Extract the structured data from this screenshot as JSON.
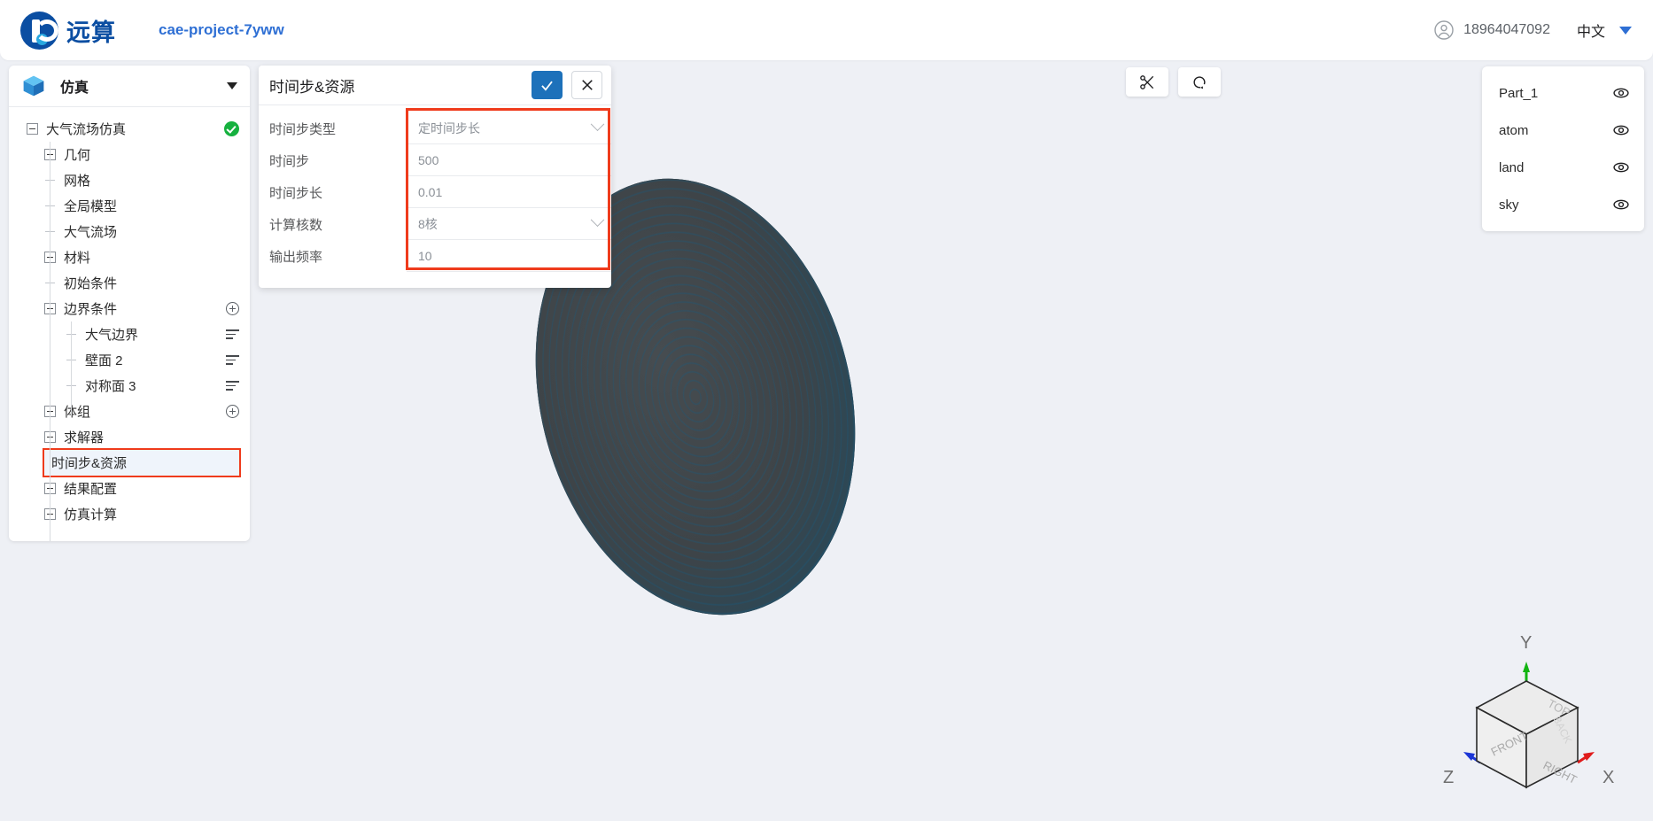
{
  "topbar": {
    "brand_text": "远算",
    "project_name": "cae-project-7yww",
    "user_phone": "18964047092",
    "language": "中文",
    "accent_color": "#0b4ea2",
    "link_color": "#2e6fd4"
  },
  "sidebar": {
    "title": "仿真",
    "tree": [
      {
        "label": "大气流场仿真",
        "toggle": "minus",
        "depth": 0,
        "right": "ok-badge"
      },
      {
        "label": "几何",
        "toggle": "plus",
        "depth": 1,
        "right": ""
      },
      {
        "label": "网格",
        "toggle": "leaf",
        "depth": 1,
        "right": ""
      },
      {
        "label": "全局模型",
        "toggle": "leaf",
        "depth": 1,
        "right": ""
      },
      {
        "label": "大气流场",
        "toggle": "leaf",
        "depth": 1,
        "right": ""
      },
      {
        "label": "材料",
        "toggle": "plus",
        "depth": 1,
        "right": ""
      },
      {
        "label": "初始条件",
        "toggle": "leaf",
        "depth": 1,
        "right": ""
      },
      {
        "label": "边界条件",
        "toggle": "minus",
        "depth": 1,
        "right": "plus-circle"
      },
      {
        "label": "大气边界",
        "toggle": "leaf",
        "depth": 2,
        "right": "list-icon"
      },
      {
        "label": "壁面 2",
        "toggle": "leaf",
        "depth": 2,
        "right": "list-icon"
      },
      {
        "label": "对称面 3",
        "toggle": "leaf",
        "depth": 2,
        "right": "list-icon"
      },
      {
        "label": "体组",
        "toggle": "plus",
        "depth": 1,
        "right": "plus-circle"
      },
      {
        "label": "求解器",
        "toggle": "plus",
        "depth": 1,
        "right": ""
      },
      {
        "label": "时间步&资源",
        "toggle": "leaf",
        "depth": 1,
        "right": "",
        "highlight": true
      },
      {
        "label": "结果配置",
        "toggle": "plus",
        "depth": 1,
        "right": ""
      },
      {
        "label": "仿真计算",
        "toggle": "plus",
        "depth": 1,
        "right": ""
      }
    ],
    "highlight_color": "#ef3b1c"
  },
  "dialog": {
    "title": "时间步&资源",
    "confirm_label": "✓",
    "cancel_label": "✕",
    "confirm_color": "#1d71ba",
    "fields": [
      {
        "label": "时间步类型",
        "value": "定时间步长",
        "type": "select"
      },
      {
        "label": "时间步",
        "value": "500",
        "type": "input"
      },
      {
        "label": "时间步长",
        "value": "0.01",
        "type": "input"
      },
      {
        "label": "计算核数",
        "value": "8核",
        "type": "select"
      },
      {
        "label": "输出频率",
        "value": "10",
        "type": "input"
      }
    ]
  },
  "viewport": {
    "toolbar": [
      {
        "icon": "scissors-icon",
        "name": "clip-tool"
      },
      {
        "icon": "reset-view-icon",
        "name": "reset-view-tool"
      }
    ],
    "parts": [
      {
        "label": "Part_1",
        "visible": true
      },
      {
        "label": "atom",
        "visible": true
      },
      {
        "label": "land",
        "visible": true
      },
      {
        "label": "sky",
        "visible": true
      }
    ],
    "orientation_cube": {
      "axes": [
        "X",
        "Y",
        "Z"
      ],
      "faces": [
        "TOP",
        "FRONT",
        "RIGHT",
        "BACK"
      ],
      "axis_colors": {
        "x": "#e01b1b",
        "y": "#11b411",
        "z": "#1a35d6"
      }
    },
    "model_color": "#43484c",
    "mesh_color": "#1a5c82"
  }
}
